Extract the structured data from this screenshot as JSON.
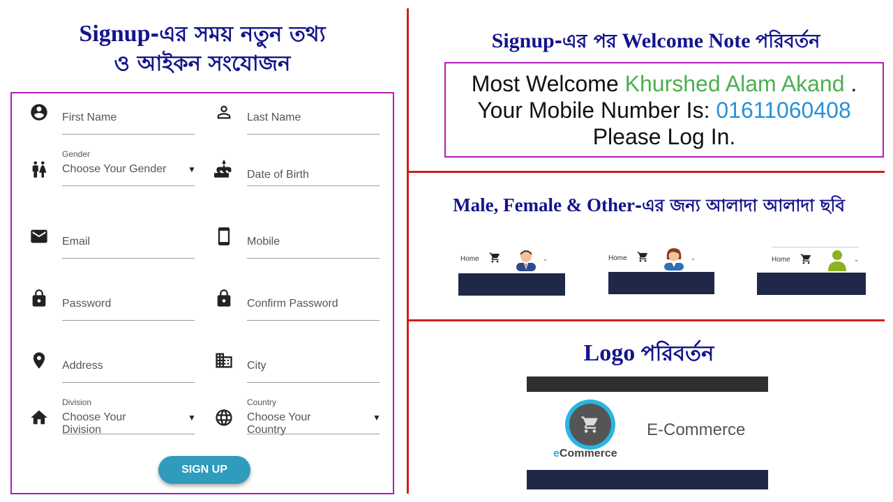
{
  "left_title": {
    "line1_en": "Signup",
    "line1_bn": "-এর সময় নতুন তথ্য",
    "line2_bn": "ও আইকন সংযোজন"
  },
  "form": {
    "fields": [
      {
        "id": "first_name",
        "placeholder": "First Name",
        "icon": "account-circle-icon"
      },
      {
        "id": "last_name",
        "placeholder": "Last Name",
        "icon": "person-outline-icon"
      },
      {
        "id": "gender",
        "label": "Gender",
        "placeholder": "Choose Your Gender",
        "icon": "wc-icon",
        "dropdown": true
      },
      {
        "id": "dob",
        "placeholder": "Date of Birth",
        "icon": "cake-icon"
      },
      {
        "id": "email",
        "placeholder": "Email",
        "icon": "mail-icon"
      },
      {
        "id": "mobile",
        "placeholder": "Mobile",
        "icon": "smartphone-icon"
      },
      {
        "id": "password",
        "placeholder": "Password",
        "icon": "lock-icon"
      },
      {
        "id": "confirm_password",
        "placeholder": "Confirm Password",
        "icon": "lock-icon"
      },
      {
        "id": "address",
        "placeholder": "Address",
        "icon": "location-pin-icon"
      },
      {
        "id": "city",
        "placeholder": "City",
        "icon": "building-icon"
      },
      {
        "id": "division",
        "label": "Division",
        "placeholder": "Choose Your Division",
        "icon": "home-icon",
        "dropdown": true
      },
      {
        "id": "country",
        "label": "Country",
        "placeholder": "Choose Your Country",
        "icon": "globe-icon",
        "dropdown": true
      }
    ],
    "dropdown_arrow": "▼",
    "signup_label": "SIGN UP"
  },
  "welcome": {
    "title_en1": "Signup",
    "title_bn1": "-এর পর",
    "title_en2": "Welcome Note",
    "title_bn2": "পরিবর্তন",
    "line1_prefix": "Most Welcome",
    "name": "Khurshed Alam Akand",
    "line1_suffix": ".",
    "line2_prefix": "Your Mobile Number Is:",
    "mobile": "01611060408",
    "line3": "Please Log In."
  },
  "gender_section": {
    "title_en": "Male, Female & Other",
    "title_bn": "-এর জন্য আলাদা আলাদা ছবি",
    "navs": [
      {
        "home": "Home",
        "avatar": "male-avatar-icon"
      },
      {
        "home": "Home",
        "avatar": "female-avatar-icon"
      },
      {
        "home": "Home",
        "avatar": "other-avatar-icon"
      }
    ],
    "chevron": "⌄"
  },
  "logo_section": {
    "title_en": "Logo",
    "title_bn": "পরিবর্তন",
    "logo_text_e": "e",
    "logo_text_rest": "Commerce",
    "brand": "E-Commerce"
  },
  "colors": {
    "heading": "#14148c",
    "border_purple": "#b01ab8",
    "divider_red": "#cc1f1f",
    "button": "#2f9bbd",
    "name_green": "#4caf50",
    "mobile_blue": "#2b8fd6",
    "navy_bar": "#1f2849"
  }
}
